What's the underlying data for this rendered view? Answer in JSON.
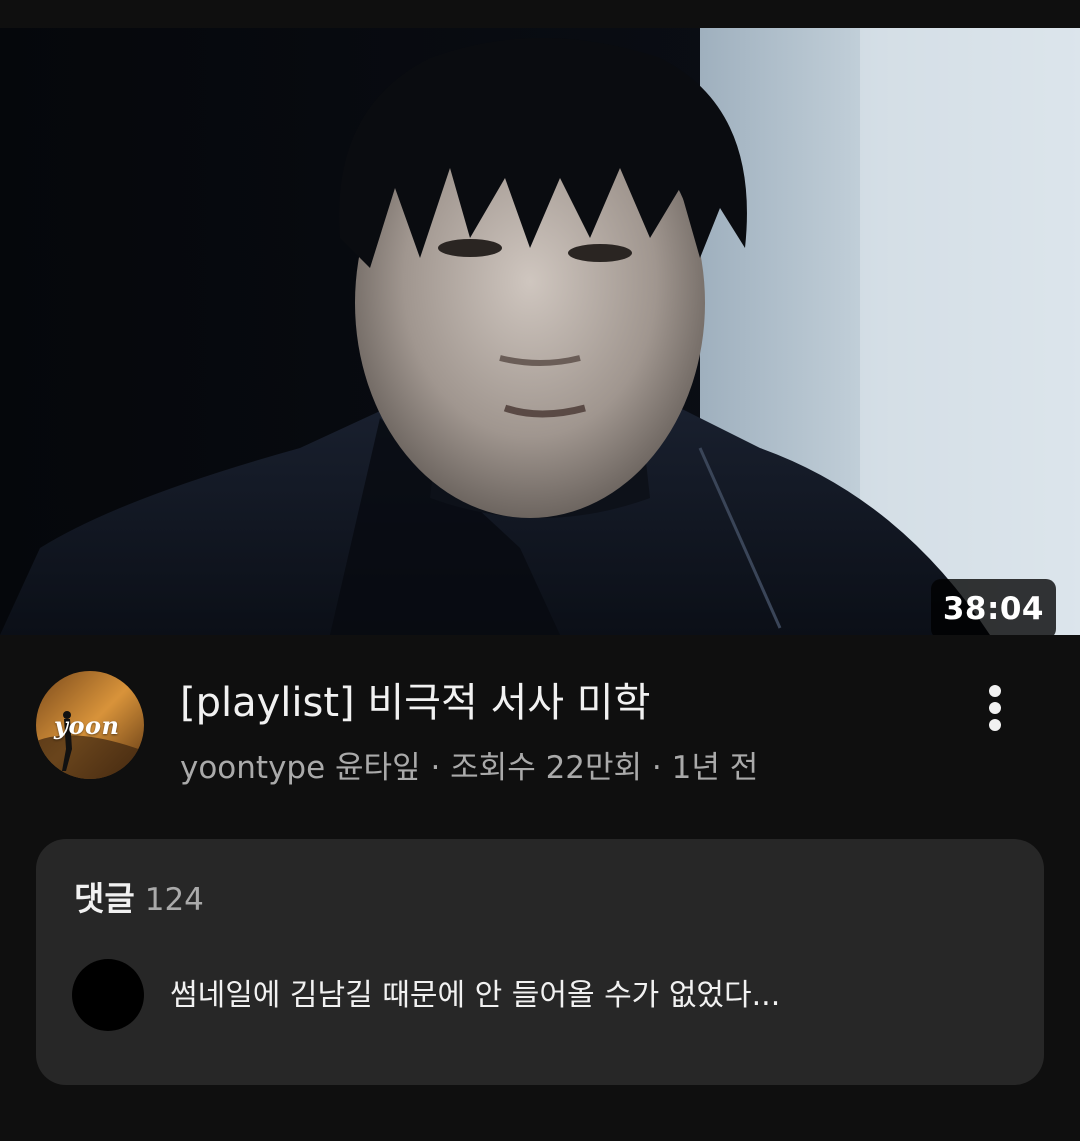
{
  "video": {
    "duration": "38:04",
    "title": "[playlist] 비극적 서사 미학",
    "channel": "yoontype 윤타잎",
    "views": "조회수 22만회",
    "age": "1년 전",
    "meta_line": "yoontype 윤타잎 · 조회수 22만회 · 1년 전"
  },
  "channel_avatar": {
    "text": "yoon"
  },
  "comments": {
    "label": "댓글",
    "count": "124",
    "top_comment": "썸네일에 김남길 때문에 안 들어올 수가 없었다..."
  },
  "icons": {
    "more": "more-vert-icon"
  },
  "colors": {
    "background": "#0f0f0f",
    "card": "#272727",
    "text_primary": "#f1f1f1",
    "text_secondary": "#aaaaaa"
  }
}
